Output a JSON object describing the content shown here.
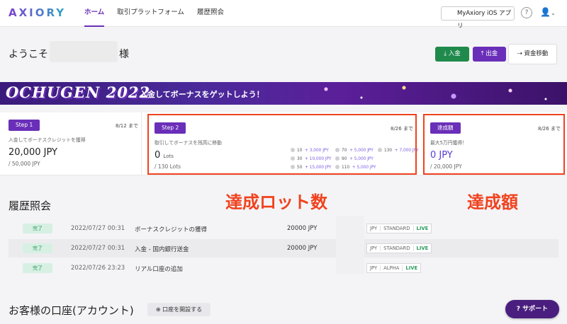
{
  "brand": {
    "logo": "AXIORY"
  },
  "nav": {
    "tabs": [
      {
        "label": "ホーム",
        "active": true
      },
      {
        "label": "取引プラットフォーム"
      },
      {
        "label": "履歴照会"
      }
    ]
  },
  "header": {
    "ios_app": "MyAxiory iOS アプリ",
    "ios_icon": "",
    "help_icon": "?",
    "user_icon": "👤",
    "chevron": "⌄"
  },
  "welcome": {
    "prefix": "ようこそ",
    "suffix": "様"
  },
  "actions": {
    "deposit": "入金",
    "withdraw": "出金",
    "transfer": "資金移動",
    "deposit_icon": "⤓",
    "withdraw_icon": "⤒",
    "transfer_icon": "⇢"
  },
  "banner": {
    "title": "OCHUGEN 2022",
    "text": "入金してボーナスをゲットしよう！"
  },
  "cards": [
    {
      "badge": "Step 1",
      "deadline": "8/12 まで",
      "desc": "入金してボーナスクレジットを獲得",
      "value": "20,000 JPY",
      "target": "/ 50,000 JPY"
    },
    {
      "badge": "Step 2",
      "deadline": "8/26 まで",
      "desc": "取引してボーナスを残高に移動",
      "value": "0",
      "unit": "Lots",
      "target": "/ 130 Lots",
      "milestones": [
        {
          "lots": "10",
          "bonus": "+ 3,000 JPY"
        },
        {
          "lots": "70",
          "bonus": "+ 5,000 JPY"
        },
        {
          "lots": "130",
          "bonus": "+ 7,000 JPY"
        },
        {
          "lots": "30",
          "bonus": "+ 10,000 JPY"
        },
        {
          "lots": "90",
          "bonus": "+ 5,000 JPY"
        },
        {
          "lots": "50",
          "bonus": "+ 15,000 JPY"
        },
        {
          "lots": "110",
          "bonus": "+ 5,000 JPY"
        }
      ]
    },
    {
      "badge": "達成額",
      "deadline": "8/26 まで",
      "desc": "最大5万円獲得！",
      "value": "0 JPY",
      "target": "/ 20,000 JPY"
    }
  ],
  "annotations": {
    "lots_label": "達成ロット数",
    "amount_label": "達成額"
  },
  "history": {
    "title": "履歴照会",
    "rows": [
      {
        "status": "完了",
        "date": "2022/07/27 00:31",
        "desc": "ボーナスクレジットの獲得",
        "amount": "20000 JPY",
        "tags": [
          "JPY",
          "STANDARD",
          "LIVE"
        ]
      },
      {
        "status": "完了",
        "date": "2022/07/27 00:31",
        "desc": "入金 - 国内銀行送金",
        "amount": "20000 JPY",
        "tags": [
          "JPY",
          "STANDARD",
          "LIVE"
        ]
      },
      {
        "status": "完了",
        "date": "2022/07/26 23:23",
        "desc": "リアル口座の追加",
        "amount": "",
        "tags": [
          "JPY",
          "ALPHA",
          "LIVE"
        ]
      }
    ]
  },
  "accounts": {
    "title": "お客様の口座(アカウント)",
    "open_button": "口座を開設する",
    "open_icon": "⊕"
  },
  "support": {
    "label": "サポート",
    "icon": "?"
  }
}
